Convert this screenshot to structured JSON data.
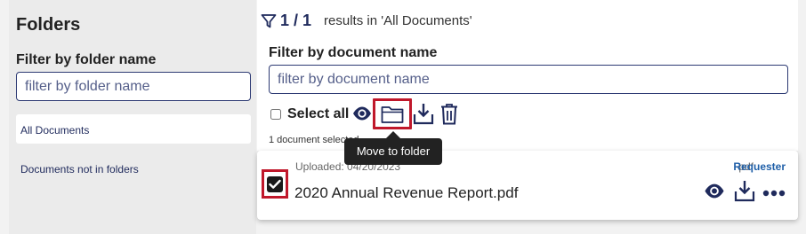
{
  "sidebar": {
    "title": "Folders",
    "filter_label": "Filter by folder name",
    "filter_placeholder": "filter by folder name",
    "items": [
      {
        "label": "All Documents"
      },
      {
        "label": "Documents not in folders"
      }
    ]
  },
  "main": {
    "results_count": "1 / 1",
    "results_text": "results in 'All Documents'",
    "filter_label": "Filter by document name",
    "filter_placeholder": "filter by document name",
    "toolbar": {
      "select_all_label": "Select all",
      "icons": [
        "eye-icon",
        "folder-icon",
        "download-icon",
        "trash-icon"
      ]
    },
    "selection_status": "1 document selected",
    "tooltip": "Move to folder"
  },
  "document": {
    "uploaded": "Uploaded: 04/20/2023",
    "type": "pdf",
    "requester": "Requester",
    "name": "2020 Annual Revenue Report.pdf",
    "checked": true,
    "actions": [
      "eye-icon",
      "download-icon",
      "more-icon"
    ]
  },
  "colors": {
    "navy": "#1f2a5c",
    "highlight": "#c0182b",
    "link": "#1f5fa8",
    "tooltip_bg": "#222222"
  }
}
